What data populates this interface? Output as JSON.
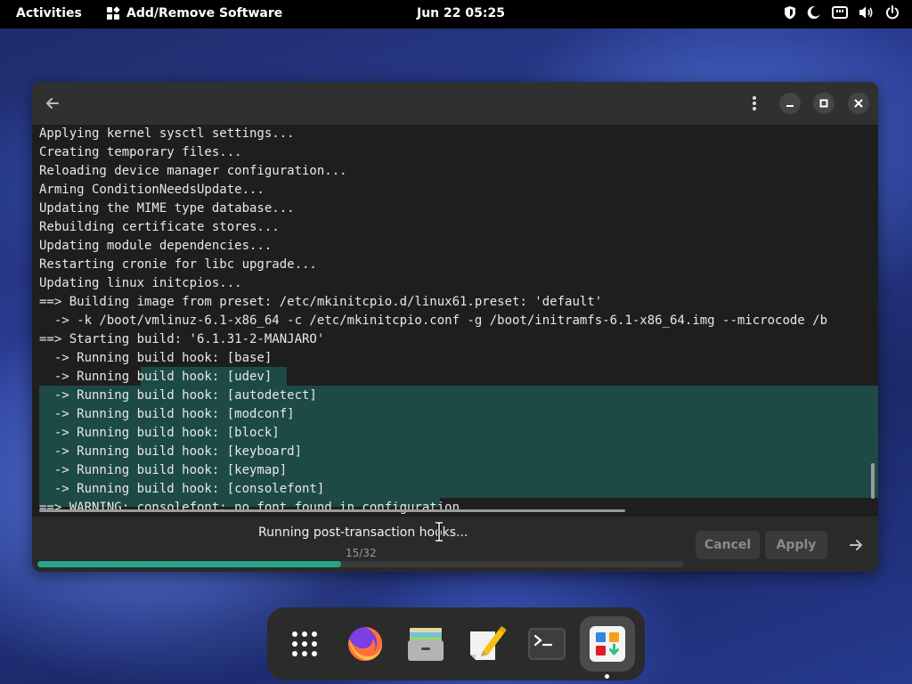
{
  "topbar": {
    "activities": "Activities",
    "app_name": "Add/Remove Software",
    "clock": "Jun 22  05:25"
  },
  "terminal": {
    "lines": [
      "Applying kernel sysctl settings...",
      "Creating temporary files...",
      "Reloading device manager configuration...",
      "Arming ConditionNeedsUpdate...",
      "Updating the MIME type database...",
      "Rebuilding certificate stores...",
      "Updating module dependencies...",
      "Restarting cronie for libc upgrade...",
      "Updating linux initcpios...",
      "==> Building image from preset: /etc/mkinitcpio.d/linux61.preset: 'default'",
      "  -> -k /boot/vmlinuz-6.1-x86_64 -c /etc/mkinitcpio.conf -g /boot/initramfs-6.1-x86_64.img --microcode /b",
      "==> Starting build: '6.1.31-2-MANJARO'",
      "  -> Running build hook: [base]",
      "  -> Running build hook: [udev]",
      "  -> Running build hook: [autodetect]",
      "  -> Running build hook: [modconf]",
      "  -> Running build hook: [block]",
      "  -> Running build hook: [keyboard]",
      "  -> Running build hook: [keymap]",
      "  -> Running build hook: [consolefont]",
      "==> WARNING: consolefont: no font found in configuration"
    ]
  },
  "footer": {
    "status": "Running post-transaction hooks...",
    "count": "15/32",
    "progress": 0.47,
    "cancel_label": "Cancel",
    "apply_label": "Apply"
  },
  "colors": {
    "accent": "#26a488",
    "selection": "#1d4a45",
    "terminal_bg": "#1e1e1e"
  },
  "dock": {
    "items": [
      "app-grid-icon",
      "firefox-icon",
      "file-manager-icon",
      "text-editor-icon",
      "terminal-icon",
      "software-icon"
    ]
  }
}
